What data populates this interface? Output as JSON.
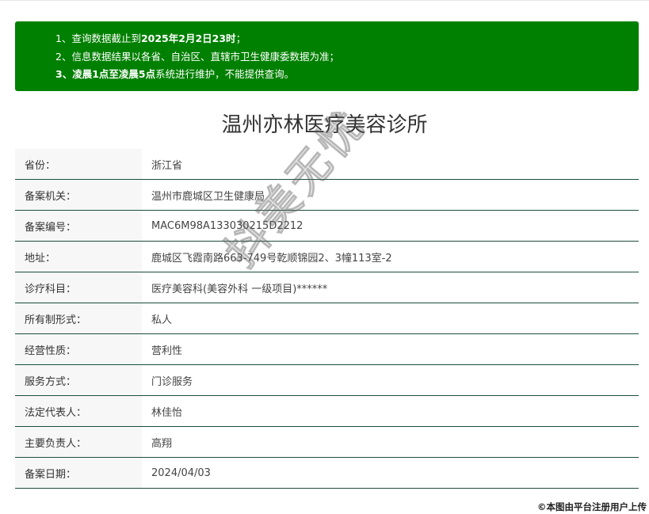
{
  "notice": {
    "line1_prefix": "1、查询数据截止到",
    "line1_bold": "2025年2月2日23时",
    "line1_suffix": "；",
    "line2": "2、信息数据结果以各省、自治区、直辖市卫生健康委数据为准；",
    "line3_prefix": "3、",
    "line3_bold": "凌晨1点至凌晨5点",
    "line3_suffix": "系统进行维护，不能提供查询。",
    "background_color": "#008000"
  },
  "title": "温州亦林医疗美容诊所",
  "rows": [
    {
      "label": "省份：",
      "value": "浙江省"
    },
    {
      "label": "备案机关：",
      "value": "温州市鹿城区卫生健康局"
    },
    {
      "label": "备案编号：",
      "value": "MAC6M98A133030215D2212"
    },
    {
      "label": "地址：",
      "value": "鹿城区飞霞南路663-749号乾顺锦园2、3幢113室-2"
    },
    {
      "label": "诊疗科目：",
      "value": "医疗美容科(美容外科 一级项目)******"
    },
    {
      "label": "所有制形式：",
      "value": "私人"
    },
    {
      "label": "经营性质：",
      "value": "营利性"
    },
    {
      "label": "服务方式：",
      "value": "门诊服务"
    },
    {
      "label": "法定代表人：",
      "value": "林佳怡"
    },
    {
      "label": "主要负责人：",
      "value": "高翔"
    },
    {
      "label": "备案日期：",
      "value": "2024/04/03"
    }
  ],
  "watermark": "抖美无忧",
  "credit": "©本图由平台注册用户上传"
}
